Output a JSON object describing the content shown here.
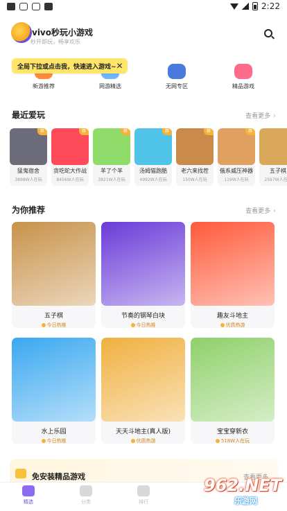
{
  "status_bar": {
    "time": "2:22"
  },
  "header": {
    "app_name": "vivo秒玩小游戏",
    "slogan": "秒开即玩，畅享欢乐"
  },
  "tooltip": {
    "text": "全局下拉或点击我，快速进入游戏~",
    "close": "✕"
  },
  "categories": [
    {
      "label": "新游推荐",
      "color": "#ff8a3d"
    },
    {
      "label": "网游精选",
      "color": "#6fb6ff"
    },
    {
      "label": "无网专区",
      "color": "#4a7bdc"
    },
    {
      "label": "精品游戏",
      "color": "#ff6b8a"
    }
  ],
  "recent": {
    "title": "最近爱玩",
    "more": "查看更多",
    "items": [
      {
        "name": "猛鬼宿舍",
        "plays": "3898W人在玩",
        "color": "#6b6b7a",
        "tag": "荐"
      },
      {
        "name": "贪吃蛇大作战",
        "plays": "8456W人在玩",
        "color": "#ff4a5a",
        "tag": "荐"
      },
      {
        "name": "羊了个羊",
        "plays": "3821W人在玩",
        "color": "#8fdc6b",
        "tag": "荐"
      },
      {
        "name": "汤姆猫跑酷",
        "plays": "4992W人在玩",
        "color": "#4fc3e8",
        "tag": "荐"
      },
      {
        "name": "老六来找茬",
        "plays": "150W人在玩",
        "color": "#c98a4a",
        "tag": "荐"
      },
      {
        "name": "俄系威压神器",
        "plays": "119W人在玩",
        "color": "#e0a060",
        "tag": "荐"
      },
      {
        "name": "五子棋",
        "plays": "2597W人在玩",
        "color": "#d9a85a",
        "tag": "荐"
      }
    ]
  },
  "recommend": {
    "title": "为你推荐",
    "more": "查看更多",
    "items": [
      {
        "name": "五子棋",
        "sub": "今日热推",
        "color": "#c8924a"
      },
      {
        "name": "节奏的钢琴白块",
        "sub": "今日热推",
        "color": "#6a3bd8"
      },
      {
        "name": "趣友斗地主",
        "sub": "优质热游",
        "color": "#ff5a3a"
      },
      {
        "name": "水上乐园",
        "sub": "今日热推",
        "color": "#3aa8f0"
      },
      {
        "name": "天天斗地主(真人版)",
        "sub": "优质热游",
        "color": "#f0b040"
      },
      {
        "name": "宝宝穿新衣",
        "sub": "518W人在玩",
        "color": "#8fd06a"
      }
    ]
  },
  "promo": {
    "title": "免安装精品游戏",
    "more": "查看更多"
  },
  "bottom_nav": [
    {
      "label": "精选",
      "active": true
    },
    {
      "label": "分类",
      "active": false
    },
    {
      "label": "排行",
      "active": false
    }
  ],
  "watermark": {
    "brand": "962.NET",
    "sub": "乐游网"
  }
}
